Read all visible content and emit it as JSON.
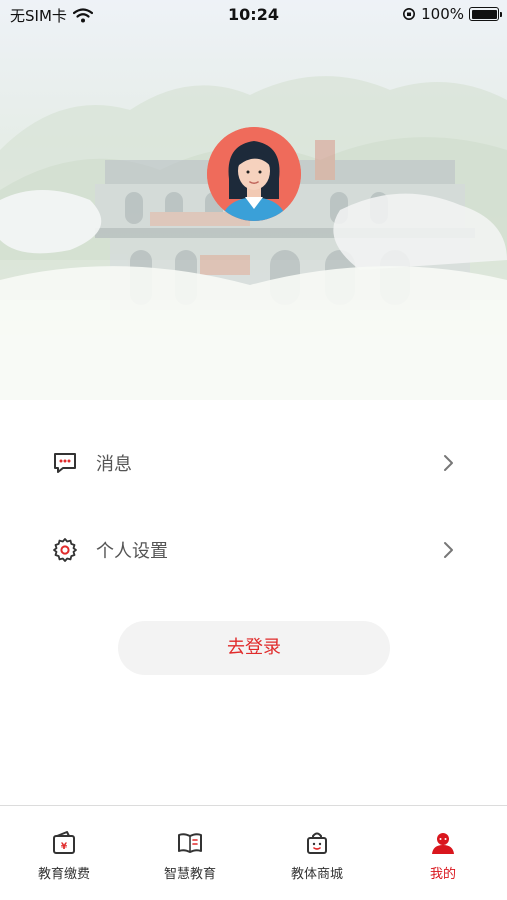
{
  "status_bar": {
    "carrier": "无SIM卡",
    "time": "10:24",
    "battery": "100%"
  },
  "profile": {
    "avatar": "default-avatar"
  },
  "menu": [
    {
      "label": "消息",
      "icon": "message-icon"
    },
    {
      "label": "个人设置",
      "icon": "gear-icon"
    }
  ],
  "login_button": "去登录",
  "tabs": [
    {
      "label": "教育缴费",
      "icon": "payment-wallet-icon",
      "active": false
    },
    {
      "label": "智慧教育",
      "icon": "book-icon",
      "active": false
    },
    {
      "label": "教体商城",
      "icon": "shopping-bag-icon",
      "active": false
    },
    {
      "label": "我的",
      "icon": "user-icon",
      "active": true
    }
  ],
  "colors": {
    "accent": "#d9161d",
    "avatar_bg": "#ef6b5b",
    "button_bg": "#f3f3f3"
  }
}
